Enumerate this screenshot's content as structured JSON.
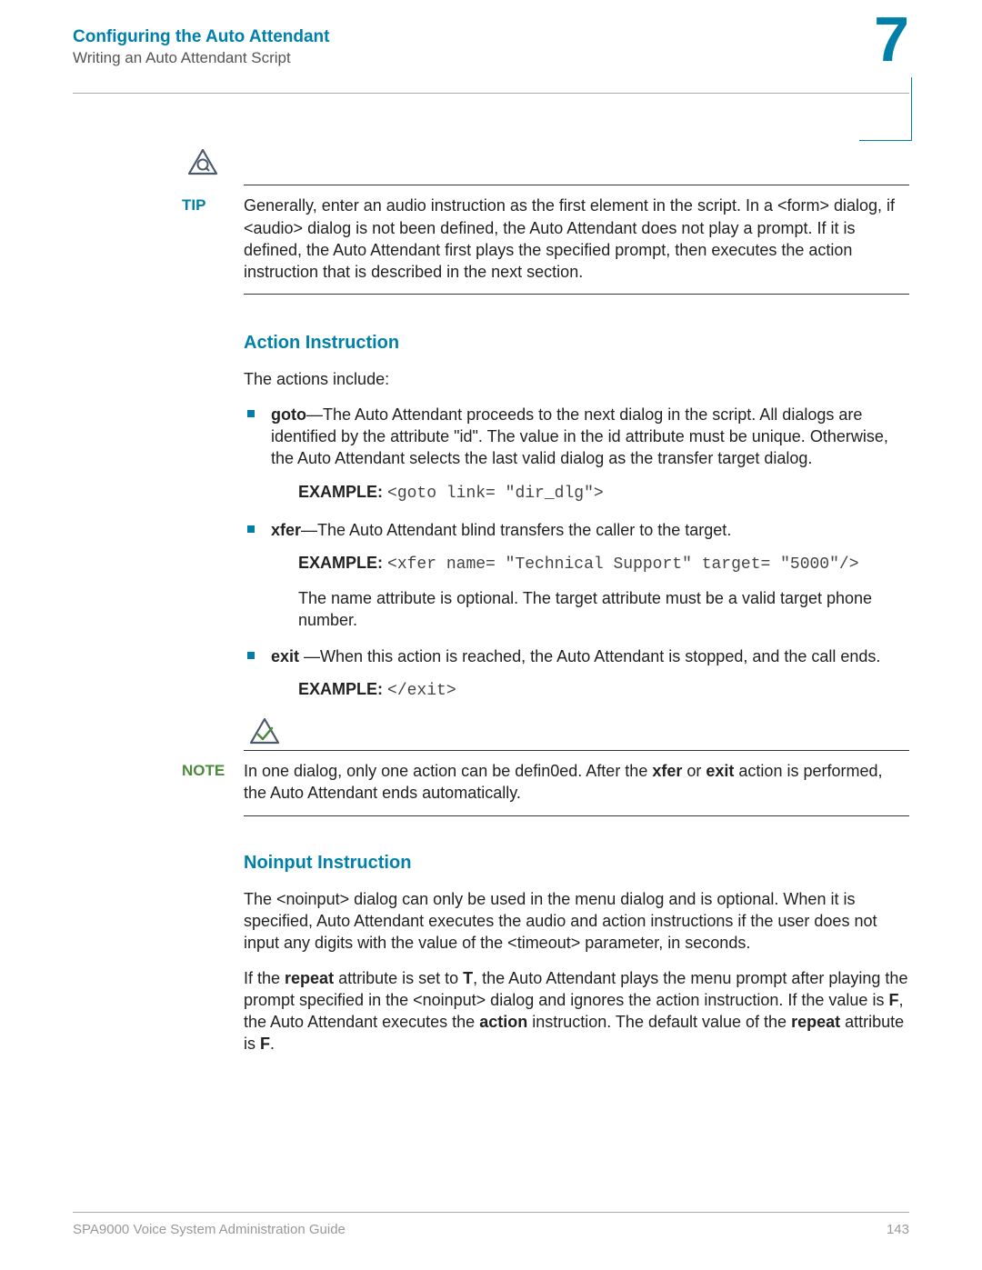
{
  "header": {
    "title": "Configuring the Auto Attendant",
    "subtitle": "Writing an Auto Attendant Script",
    "chapter": "7"
  },
  "tip": {
    "label": "TIP",
    "body": "Generally, enter an audio instruction as the first element in the script. In a <form> dialog, if <audio> dialog is not been defined, the Auto Attendant does not play a prompt. If it is defined, the Auto Attendant first plays the specified prompt, then executes the action instruction that is described in the next section."
  },
  "action_section": {
    "heading": "Action Instruction",
    "intro": "The actions include:",
    "goto": {
      "term": "goto",
      "desc": "—The Auto Attendant proceeds to the next dialog in the script. All dialogs are identified by the attribute \"id\". The value in the id attribute must be unique. Otherwise, the Auto Attendant selects the last valid dialog as the transfer target dialog.",
      "example_label": "EXAMPLE:",
      "example_code": "<goto link= \"dir_dlg\">"
    },
    "xfer": {
      "term": "xfer",
      "desc": "—The Auto Attendant blind transfers the caller to the target.",
      "example_label": "EXAMPLE:",
      "example_code": "<xfer name= \"Technical Support\" target= \"5000\"/>",
      "after": "The name attribute is optional. The target attribute must be a valid target phone number."
    },
    "exit": {
      "term": "exit",
      "desc": " —When this action is reached, the Auto Attendant is stopped, and the call ends.",
      "example_label": "EXAMPLE:",
      "example_code": "</exit>"
    }
  },
  "note": {
    "label": "NOTE",
    "pre": "In one dialog, only one action can be defin0ed. After the ",
    "b1": "xfer",
    "mid": " or ",
    "b2": "exit",
    "post": " action is performed, the Auto Attendant ends automatically."
  },
  "noinput_section": {
    "heading": "Noinput Instruction",
    "p1": "The <noinput> dialog can only be used in the menu dialog and is optional. When it is specified, Auto Attendant executes the audio and action instructions if the user does not input any digits with the value of the <timeout> parameter, in seconds.",
    "p2_a": "If the ",
    "p2_repeat": "repeat",
    "p2_b": " attribute is set to ",
    "p2_T": "T",
    "p2_c": ", the Auto Attendant plays the menu prompt after playing the prompt specified in the <noinput> dialog and ignores the action instruction. If the value is ",
    "p2_F": "F",
    "p2_d": ", the Auto Attendant executes the ",
    "p2_action": "action",
    "p2_e": " instruction. The default value of the ",
    "p2_repeat2": "repeat",
    "p2_f": " attribute is ",
    "p2_F2": "F",
    "p2_g": "."
  },
  "footer": {
    "title": "SPA9000 Voice System Administration Guide",
    "page": "143"
  }
}
